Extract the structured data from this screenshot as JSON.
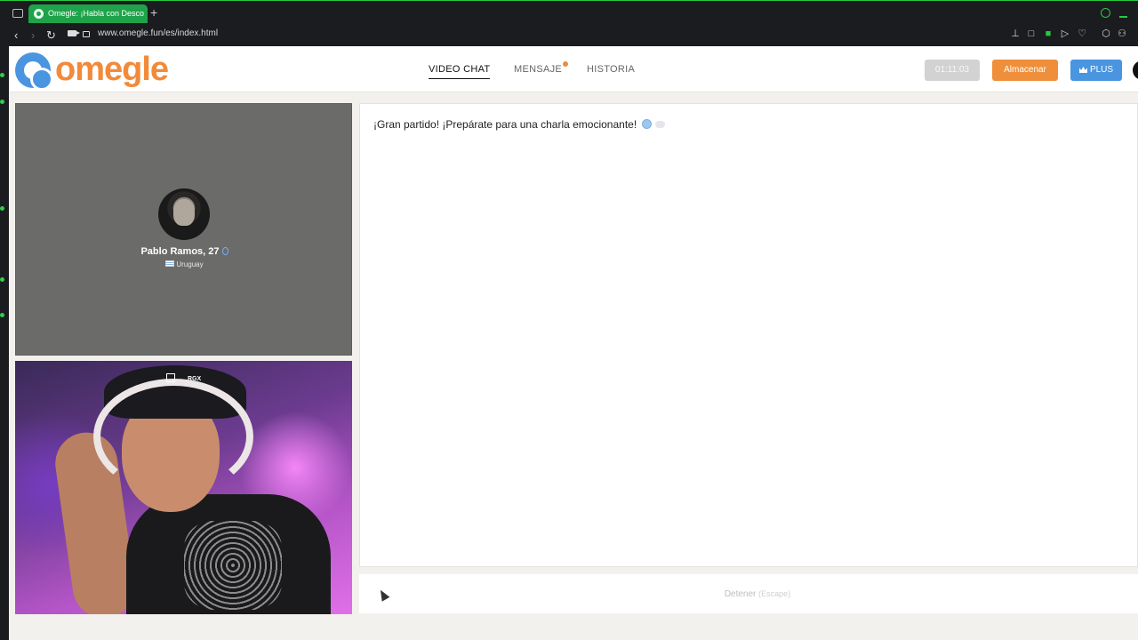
{
  "browser": {
    "tab_title": "Omegle: ¡Habla con Desco",
    "new_tab": "+",
    "url": "www.omegle.fun/es/index.html",
    "back": "‹",
    "forward": "›",
    "reload": "↻"
  },
  "header": {
    "logo_text": "omegle",
    "nav": {
      "video_chat": "VIDEO CHAT",
      "message": "MENSAJE",
      "history": "HISTORIA"
    },
    "timer": "01:11:03",
    "store_label": "Almacenar",
    "plus_label": "PLUS"
  },
  "remote": {
    "name": "Pablo Ramos, 27",
    "country": "Uruguay"
  },
  "local": {
    "pip_label": "RGX"
  },
  "chat": {
    "message": "¡Gran partido! ¡Prepárate para una charla emocionante!"
  },
  "controls": {
    "stop_label": "Detener",
    "stop_key": "(Escape)"
  },
  "colors": {
    "accent_orange": "#f08f3b",
    "brand_blue": "#4a95e0",
    "browser_green": "#1fa34a"
  }
}
